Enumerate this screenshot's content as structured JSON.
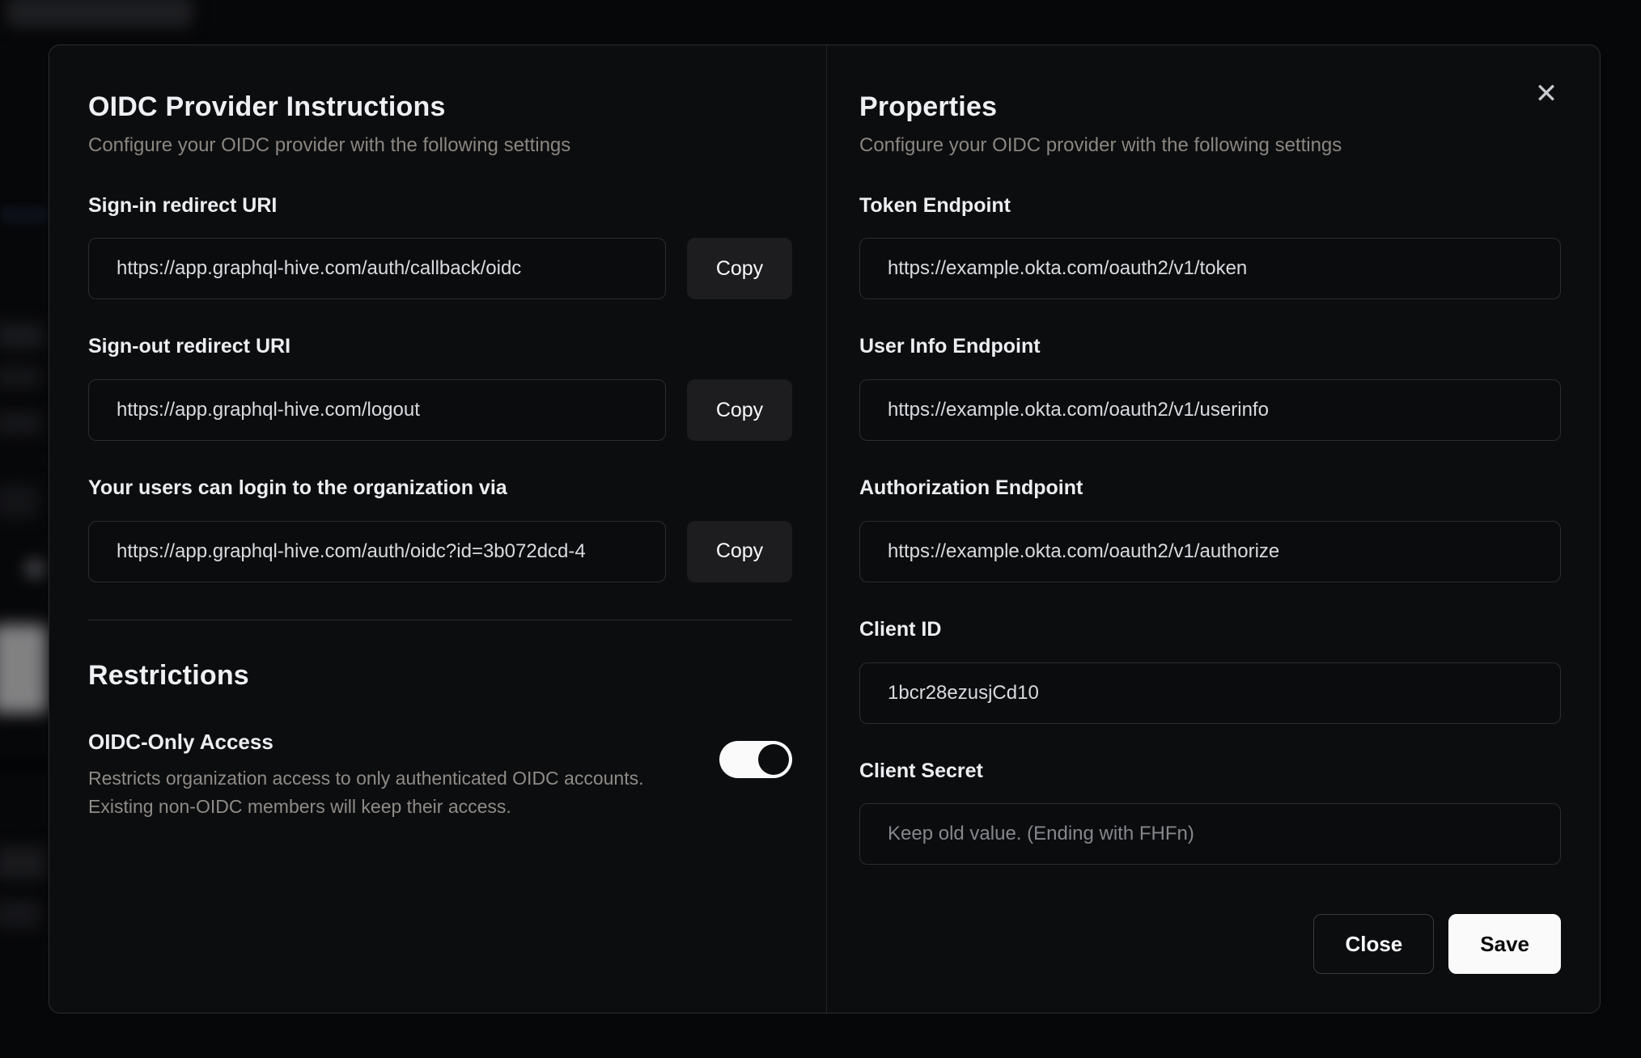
{
  "colors": {
    "page_bg": "#08090b",
    "modal_bg": "#0c0d0f",
    "modal_border": "#2e2d2a",
    "input_border": "#2d2c2f",
    "heading_text": "#eef0f3",
    "muted_text": "#8b8680",
    "accent_button_bg": "#fafafa",
    "accent_button_text": "#0b0b0d",
    "toggle_on_track": "#fafafa"
  },
  "modal": {
    "close_icon": "✕",
    "copy_label": "Copy",
    "left": {
      "title": "OIDC Provider Instructions",
      "subtitle": "Configure your OIDC provider with the following settings",
      "fields": [
        {
          "label": "Sign-in redirect URI",
          "value": "https://app.graphql-hive.com/auth/callback/oidc"
        },
        {
          "label": "Sign-out redirect URI",
          "value": "https://app.graphql-hive.com/logout"
        },
        {
          "label": "Your users can login to the organization via",
          "value": "https://app.graphql-hive.com/auth/oidc?id=3b072dcd-4"
        }
      ],
      "restrictions": {
        "title": "Restrictions",
        "oidc_only": {
          "label": "OIDC-Only Access",
          "description_line1": "Restricts organization access to only authenticated OIDC accounts.",
          "description_line2": "Existing non-OIDC members will keep their access.",
          "enabled": true
        }
      }
    },
    "right": {
      "title": "Properties",
      "subtitle": "Configure your OIDC provider with the following settings",
      "fields": [
        {
          "label": "Token Endpoint",
          "value": "https://example.okta.com/oauth2/v1/token"
        },
        {
          "label": "User Info Endpoint",
          "value": "https://example.okta.com/oauth2/v1/userinfo"
        },
        {
          "label": "Authorization Endpoint",
          "value": "https://example.okta.com/oauth2/v1/authorize"
        },
        {
          "label": "Client ID",
          "value": "1bcr28ezusjCd10"
        }
      ],
      "client_secret": {
        "label": "Client Secret",
        "value": "",
        "placeholder": "Keep old value. (Ending with FHFn)"
      },
      "buttons": {
        "close": "Close",
        "save": "Save"
      }
    }
  }
}
